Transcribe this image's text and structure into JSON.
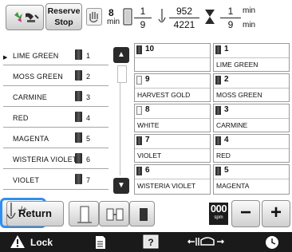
{
  "topbar": {
    "reserve_stop_line1": "Reserve",
    "reserve_stop_line2": "Stop",
    "stop_count": "8",
    "stop_count_unit": "min",
    "color_index": "1",
    "color_total": "9",
    "stitch_current": "952",
    "stitch_total": "4221",
    "time_current": "1",
    "time_current_unit": "min",
    "time_total": "9",
    "time_total_unit": "min"
  },
  "left_list": {
    "items": [
      {
        "label": "LIME GREEN",
        "number": "1"
      },
      {
        "label": "MOSS GREEN",
        "number": "2"
      },
      {
        "label": "CARMINE",
        "number": "3"
      },
      {
        "label": "RED",
        "number": "4"
      },
      {
        "label": "MAGENTA",
        "number": "5"
      },
      {
        "label": "WISTERIA VIOLET",
        "number": "6"
      },
      {
        "label": "VIOLET",
        "number": "7"
      }
    ]
  },
  "grid": {
    "left_column": [
      {
        "number": "10",
        "name": ""
      },
      {
        "number": "9",
        "name": "HARVEST GOLD"
      },
      {
        "number": "8",
        "name": "WHITE"
      },
      {
        "number": "7",
        "name": "VIOLET"
      },
      {
        "number": "6",
        "name": "WISTERIA VIOLET"
      }
    ],
    "right_column": [
      {
        "number": "1",
        "name": "LIME GREEN"
      },
      {
        "number": "2",
        "name": "MOSS GREEN"
      },
      {
        "number": "3",
        "name": "CARMINE"
      },
      {
        "number": "4",
        "name": "RED"
      },
      {
        "number": "5",
        "name": "MAGENTA"
      }
    ]
  },
  "toolbar": {
    "return_label": "Return",
    "thread_cutter_label": "-/+",
    "speed_value": "000",
    "speed_unit": "spm",
    "minus_label": "−",
    "plus_label": "+"
  },
  "footer": {
    "lock_label": "Lock"
  },
  "colors": {
    "highlight_border": "#2f8ff0",
    "footer_bg": "#1a1a1a"
  },
  "icons": [
    "machine-icon",
    "hand-icon",
    "spool-icon",
    "needle-icon",
    "hourglass-icon",
    "warning-icon",
    "page-icon",
    "help-icon",
    "frame-move-icon",
    "clock-icon"
  ]
}
